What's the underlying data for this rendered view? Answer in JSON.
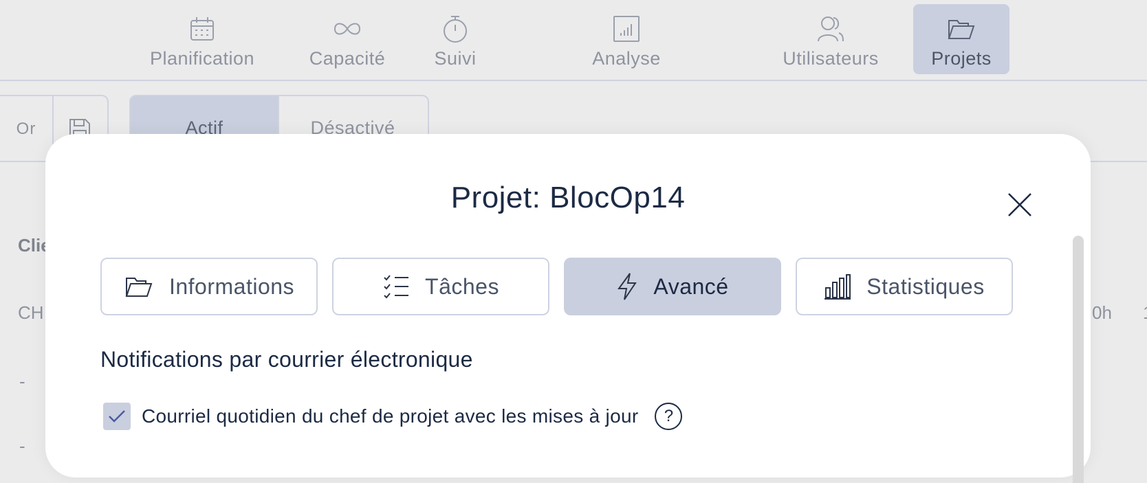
{
  "nav": {
    "items": [
      {
        "label": "Planification",
        "icon": "calendar-icon"
      },
      {
        "label": "Capacité",
        "icon": "infinity-icon"
      },
      {
        "label": "Suivi",
        "icon": "stopwatch-icon"
      },
      {
        "label": "Analyse",
        "icon": "bar-chart-icon"
      },
      {
        "label": "Utilisateurs",
        "icon": "users-icon"
      },
      {
        "label": "Projets",
        "icon": "folder-open-icon"
      }
    ],
    "active": "Projets"
  },
  "toolbar": {
    "or_label": "Or",
    "save_icon": "floppy-disk-icon",
    "filter_active": "Actif",
    "filter_inactive": "Désactivé",
    "selected_filter": "Actif"
  },
  "background": {
    "col_header_partial": "Clie",
    "row1_partial": "CH",
    "row1_value_partial": "0h",
    "row2_partial": "-",
    "row3_partial": "-",
    "edge_char": "1"
  },
  "modal": {
    "title": "Projet: BlocOp14",
    "close_icon": "close-icon",
    "tabs": [
      {
        "label": "Informations",
        "icon": "folder-open-icon"
      },
      {
        "label": "Tâches",
        "icon": "task-list-icon"
      },
      {
        "label": "Avancé",
        "icon": "lightning-icon"
      },
      {
        "label": "Statistiques",
        "icon": "bar-chart-icon"
      }
    ],
    "active_tab": "Avancé",
    "section_title": "Notifications par courrier électronique",
    "checkbox": {
      "label": "Courriel quotidien du chef de projet avec les mises à jour",
      "checked": true
    },
    "help_symbol": "?"
  },
  "colors": {
    "accent_bg": "#c9cfde",
    "text_dark": "#1c2a44",
    "muted_text": "#8e939e",
    "page_bg": "#ebebec"
  }
}
